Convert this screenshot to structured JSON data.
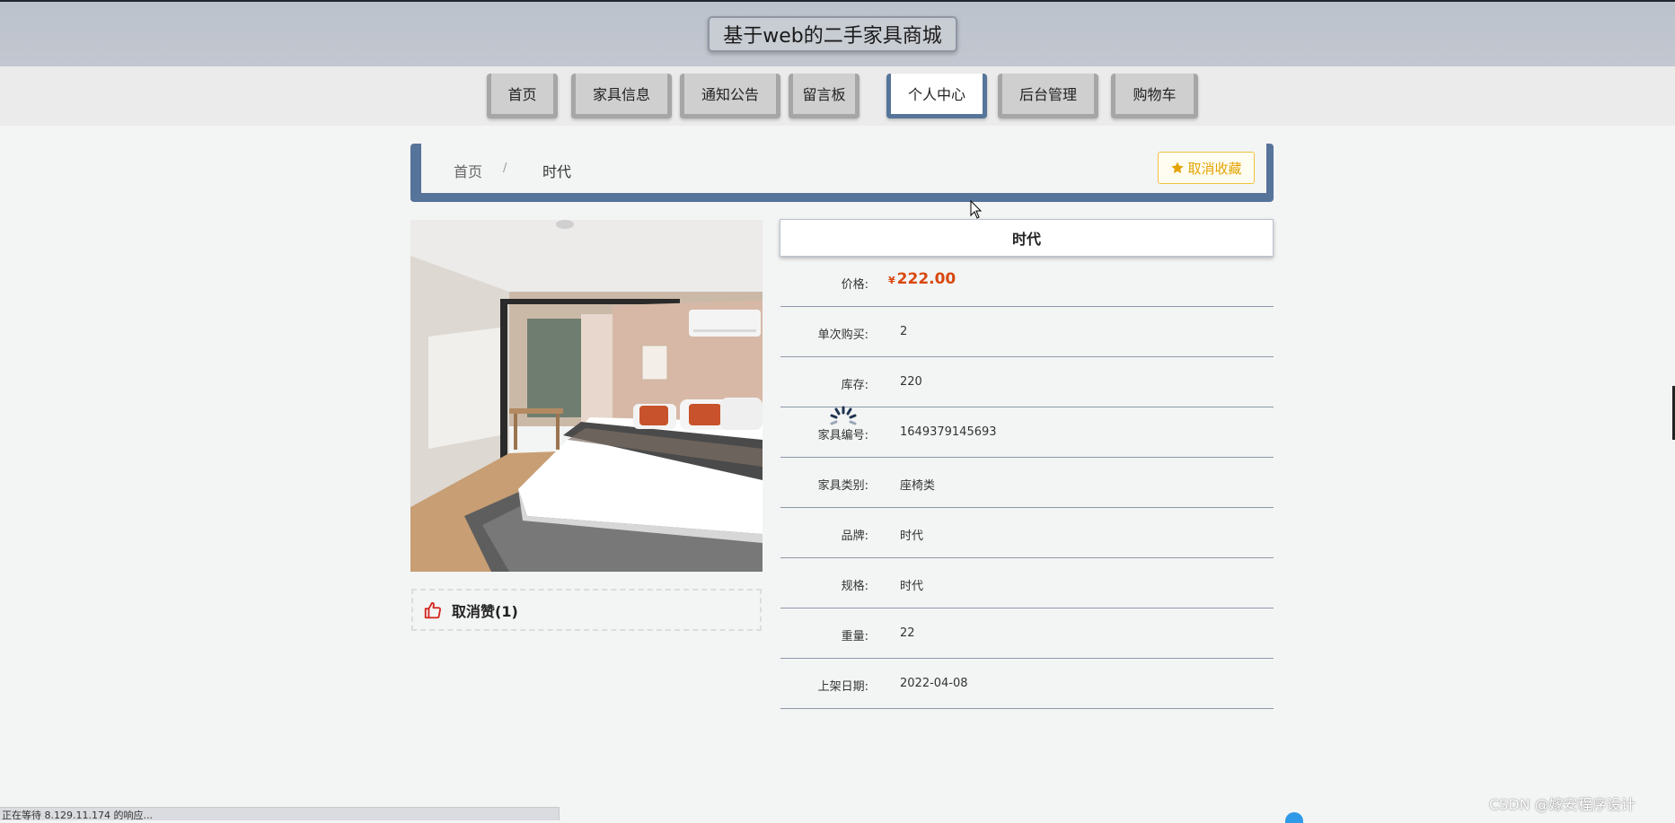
{
  "header": {
    "site_title": "基于web的二手家具商城"
  },
  "nav": {
    "items": [
      {
        "label": "首页"
      },
      {
        "label": "家具信息"
      },
      {
        "label": "通知公告"
      },
      {
        "label": "留言板"
      },
      {
        "label": "个人中心",
        "active": true
      },
      {
        "label": "后台管理"
      },
      {
        "label": "购物车"
      }
    ]
  },
  "breadcrumb": {
    "home": "首页",
    "separator": "/",
    "current": "时代"
  },
  "favorite_button": {
    "label": "取消收藏",
    "icon": "star-icon",
    "color": "#e3a400"
  },
  "product": {
    "image_alt": "bedroom-photo",
    "like": {
      "label": "取消赞(1)",
      "icon": "thumbs-up-icon",
      "color": "#d4261f"
    }
  },
  "detail": {
    "title": "时代",
    "price": {
      "label": "价格:",
      "currency": "¥",
      "value": "222.00"
    },
    "rows": [
      {
        "label": "单次购买:",
        "value": "2"
      },
      {
        "label": "库存:",
        "value": "220"
      },
      {
        "label": "家具编号:",
        "value": "1649379145693"
      },
      {
        "label": "家具类别:",
        "value": "座椅类"
      },
      {
        "label": "品牌:",
        "value": "时代"
      },
      {
        "label": "规格:",
        "value": "时代"
      },
      {
        "label": "重量:",
        "value": "22"
      },
      {
        "label": "上架日期:",
        "value": "2022-04-08"
      }
    ]
  },
  "status_bar": {
    "text": "正在等待 8.129.11.174 的响应..."
  },
  "watermark": {
    "text": "CSDN @嫁安程序设计"
  },
  "colors": {
    "accent": "#56739a",
    "price": "#d9480f",
    "nav_inactive_border": "#a6a6a6"
  }
}
